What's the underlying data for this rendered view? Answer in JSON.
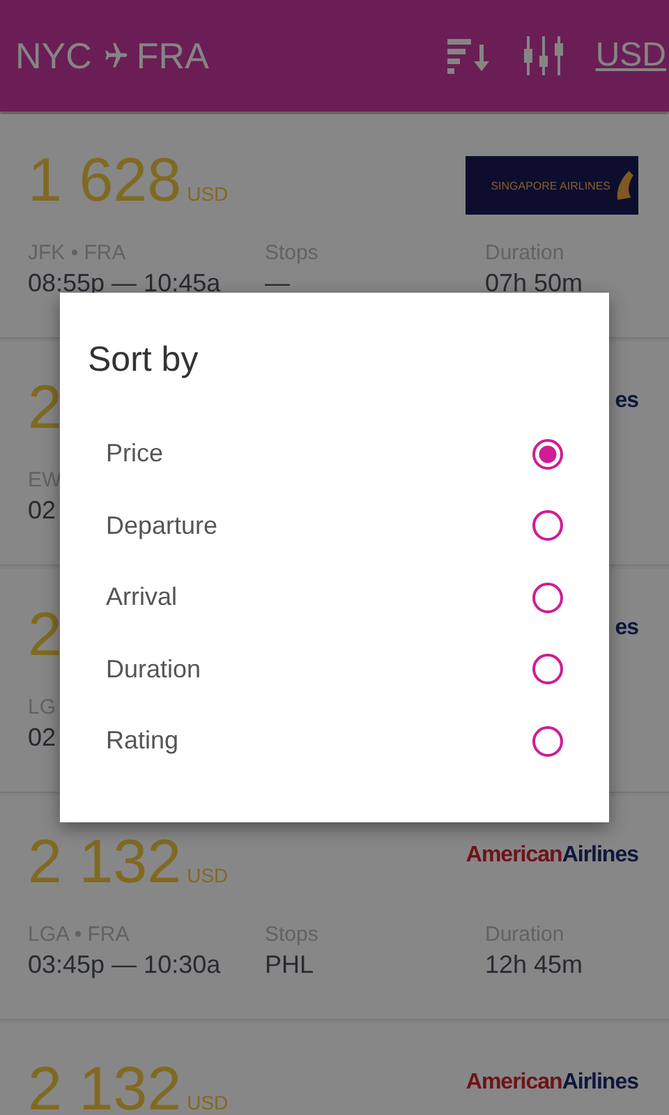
{
  "header": {
    "origin": "NYC",
    "destination": "FRA",
    "currency": "USD"
  },
  "flights": [
    {
      "price": "1 628",
      "currency": "USD",
      "logo": {
        "kind": "badge",
        "parts": [
          {
            "text": "SINGAPORE AIRLINES",
            "kind": "accent"
          }
        ]
      },
      "route": "JFK • FRA",
      "times": "08:55p — 10:45a",
      "stops_label": "Stops",
      "stops": "—",
      "duration_label": "Duration",
      "duration": "07h 50m"
    },
    {
      "price": "2",
      "logo": {
        "kind": "wordmark",
        "parts": [
          {
            "text": "es",
            "kind": "secondary"
          }
        ]
      },
      "route": "EW",
      "times": "02"
    },
    {
      "price": "2",
      "logo": {
        "kind": "wordmark",
        "parts": [
          {
            "text": "es",
            "kind": "secondary"
          }
        ]
      },
      "route": "LG",
      "times": "02"
    },
    {
      "price": "2 132",
      "currency": "USD",
      "logo": {
        "kind": "wordmark",
        "parts": [
          {
            "text": "American",
            "kind": "primary"
          },
          {
            "text": "Airlines",
            "kind": "secondary"
          }
        ]
      },
      "route": "LGA • FRA",
      "times": "03:45p — 10:30a",
      "stops_label": "Stops",
      "stops": "PHL",
      "duration_label": "Duration",
      "duration": "12h 45m"
    },
    {
      "price": "2 132",
      "currency": "USD",
      "logo": {
        "kind": "wordmark",
        "parts": [
          {
            "text": "American",
            "kind": "primary"
          },
          {
            "text": "Airlines",
            "kind": "secondary"
          }
        ]
      }
    }
  ],
  "sort_dialog": {
    "title": "Sort by",
    "options": [
      {
        "label": "Price",
        "selected": true
      },
      {
        "label": "Departure",
        "selected": false
      },
      {
        "label": "Arrival",
        "selected": false
      },
      {
        "label": "Duration",
        "selected": false
      },
      {
        "label": "Rating",
        "selected": false
      }
    ]
  }
}
